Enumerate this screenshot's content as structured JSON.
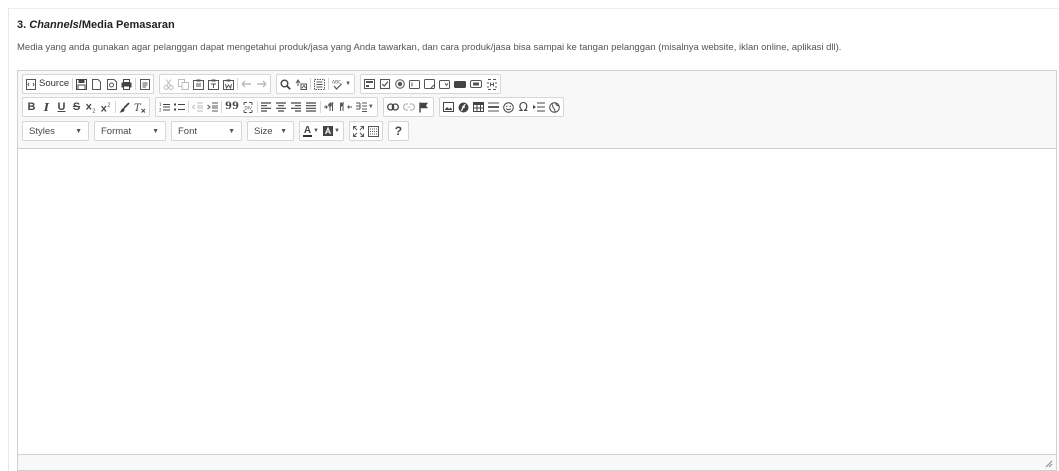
{
  "section": {
    "number": "3.",
    "title_italic": "Channels",
    "title_rest": "/Media Pemasaran",
    "description": "Media yang anda gunakan agar pelanggan dapat mengetahui produk/jasa yang Anda tawarkan, dan cara produk/jasa bisa sampai ke tangan pelanggan (misalnya website, iklan online, aplikasi dll)."
  },
  "editor": {
    "content": "",
    "toolbar": {
      "source_label": "Source",
      "styles_label": "Styles",
      "format_label": "Format",
      "font_label": "Font",
      "size_label": "Size",
      "help_glyph": "?",
      "bold_glyph": "B",
      "italic_glyph": "I",
      "underline_glyph": "U",
      "strike_glyph": "S",
      "quote_glyph": "99",
      "omega_glyph": "Ω",
      "text_color_glyph": "A"
    }
  }
}
